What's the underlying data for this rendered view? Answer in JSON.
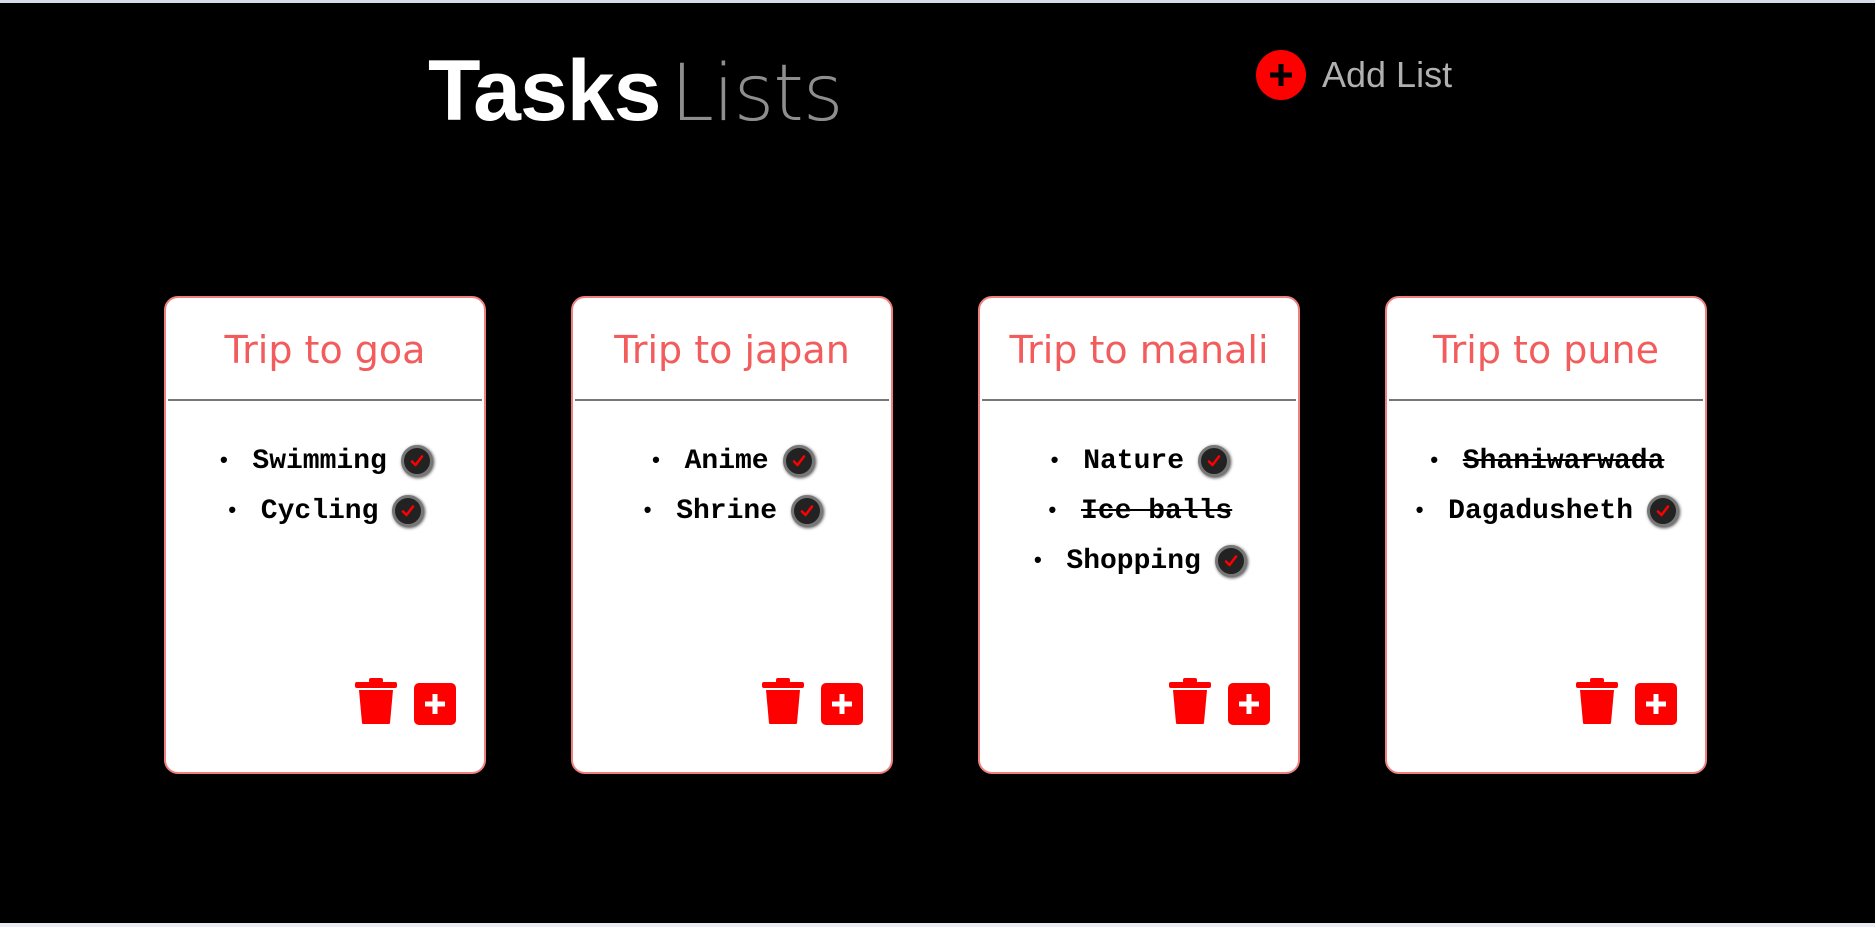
{
  "header": {
    "title_bold": "Tasks",
    "title_light": "Lists",
    "add_list_label": "Add List"
  },
  "colors": {
    "accent": "#ff0000",
    "card_title": "#f25c5c",
    "background": "#000000"
  },
  "icons": {
    "add_list": "plus-circle-icon",
    "check": "check-circle-icon",
    "delete": "trash-icon",
    "add_task": "plus-square-icon"
  },
  "lists": [
    {
      "title": "Trip to goa",
      "tasks": [
        {
          "text": "Swimming",
          "done": false
        },
        {
          "text": "Cycling",
          "done": false
        }
      ]
    },
    {
      "title": "Trip to japan",
      "tasks": [
        {
          "text": "Anime",
          "done": false
        },
        {
          "text": "Shrine",
          "done": false
        }
      ]
    },
    {
      "title": "Trip to manali",
      "tasks": [
        {
          "text": "Nature",
          "done": false
        },
        {
          "text": "Ice balls",
          "done": true
        },
        {
          "text": "Shopping",
          "done": false
        }
      ]
    },
    {
      "title": "Trip to pune",
      "tasks": [
        {
          "text": "Shaniwarwada",
          "done": true
        },
        {
          "text": "Dagadusheth",
          "done": false
        }
      ]
    }
  ]
}
